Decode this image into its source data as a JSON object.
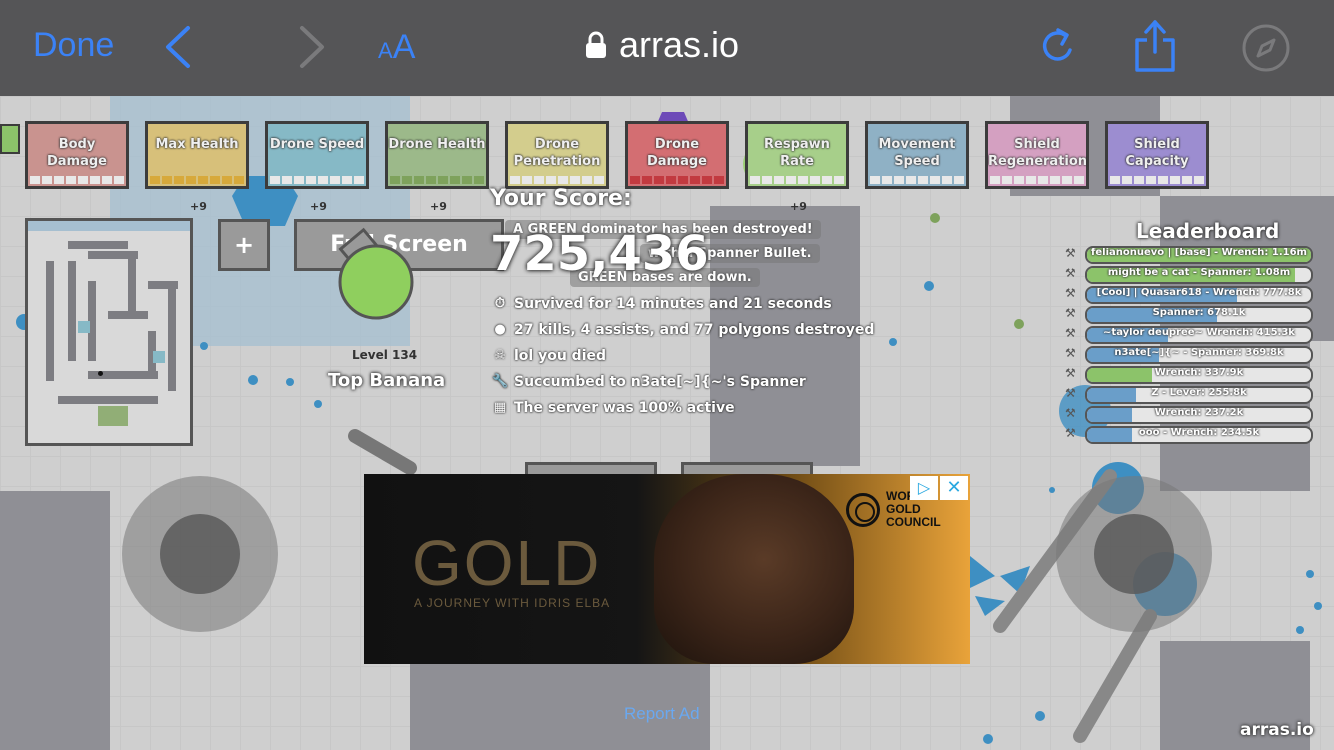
{
  "browser": {
    "done_label": "Done",
    "text_size_small": "A",
    "text_size_large": "A",
    "url": "arras.io"
  },
  "colors": {
    "toolbar_bg": "#555557",
    "accent": "#3b82f6"
  },
  "upgrades": [
    {
      "label": "Body Damage",
      "color": "#c9938f",
      "pip_color": "#e8e8e8"
    },
    {
      "label": "Max Health",
      "color": "#d7c07a",
      "pip_color": "#d7a93b"
    },
    {
      "label": "Drone Speed",
      "color": "#86b9c6",
      "pip_color": "#e8e8e8"
    },
    {
      "label": "Drone Health",
      "color": "#9cb98a",
      "pip_color": "#7ea25c"
    },
    {
      "label": "Drone Penetration",
      "color": "#d3cd8d",
      "pip_color": "#e8e8e8"
    },
    {
      "label": "Drone Damage",
      "color": "#d36e72",
      "pip_color": "#c23a40"
    },
    {
      "label": "Respawn Rate",
      "color": "#a7cf8a",
      "pip_color": "#e8e8e8"
    },
    {
      "label": "Movement Speed",
      "color": "#8fb1c5",
      "pip_color": "#e8e8e8"
    },
    {
      "label": "Shield Regeneration",
      "color": "#d4a0c1",
      "pip_color": "#e8e8e8"
    },
    {
      "label": "Shield Capacity",
      "color": "#9c8dd0",
      "pip_color": "#e8e8e8"
    }
  ],
  "upgrade_bonus": "+9",
  "score": {
    "title": "Your Score:",
    "value": "725,436"
  },
  "messages": [
    "A GREEN dominator has been destroyed!",
    "with a Spanner Bullet.",
    "GREEN bases are down."
  ],
  "death_stats": [
    {
      "icon": "clock-icon",
      "glyph": "⏱",
      "text": "Survived for 14 minutes and 21 seconds"
    },
    {
      "icon": "bomb-icon",
      "glyph": "●",
      "text": "27 kills, 4 assists, and 77 polygons destroyed"
    },
    {
      "icon": "skull-icon",
      "glyph": "☠",
      "text": "lol you died"
    },
    {
      "icon": "wrench-icon",
      "glyph": "🔧",
      "text": "Succumbed to n3ate[~]{~'s Spanner"
    },
    {
      "icon": "server-icon",
      "glyph": "▦",
      "text": "The server was 100% active"
    }
  ],
  "player": {
    "level": "Level 134",
    "name": "Top Banana",
    "full_screen_label": "Full Screen",
    "plus_label": "+"
  },
  "leaderboard": {
    "title": "Leaderboard",
    "entries": [
      {
        "text": "felianonuevo | [base] - Wrench: 1.16m",
        "fill": 1.0,
        "color": "#8cc36a"
      },
      {
        "text": "might be a cat - Spanner: 1.08m",
        "fill": 0.93,
        "color": "#8cc36a"
      },
      {
        "text": "[Cool] | Quasar618 - Wrench: 777.8k",
        "fill": 0.67,
        "color": "#6a9ec9"
      },
      {
        "text": "Spanner: 678.1k",
        "fill": 0.58,
        "color": "#6a9ec9"
      },
      {
        "text": "~taylor deupree~ Wrench: 415.3k",
        "fill": 0.36,
        "color": "#6a9ec9"
      },
      {
        "text": "n3ate[~]{~ - Spanner: 369.8k",
        "fill": 0.32,
        "color": "#6a9ec9"
      },
      {
        "text": "Wrench: 337.9k",
        "fill": 0.29,
        "color": "#8cc36a"
      },
      {
        "text": "Z - Lever: 255.8k",
        "fill": 0.22,
        "color": "#6a9ec9"
      },
      {
        "text": "Wrench: 237.2k",
        "fill": 0.2,
        "color": "#6a9ec9"
      },
      {
        "text": "ooo - Wrench: 234.5k",
        "fill": 0.2,
        "color": "#6a9ec9"
      }
    ]
  },
  "ad": {
    "headline": "GOLD",
    "tagline": "A JOURNEY WITH IDRIS ELBA",
    "brand_line1": "WORLD",
    "brand_line2": "GOLD",
    "brand_line3": "COUNCIL",
    "choices_glyph": "▷",
    "close_glyph": "✕",
    "report_label": "Report Ad"
  },
  "watermark": "arras.io"
}
